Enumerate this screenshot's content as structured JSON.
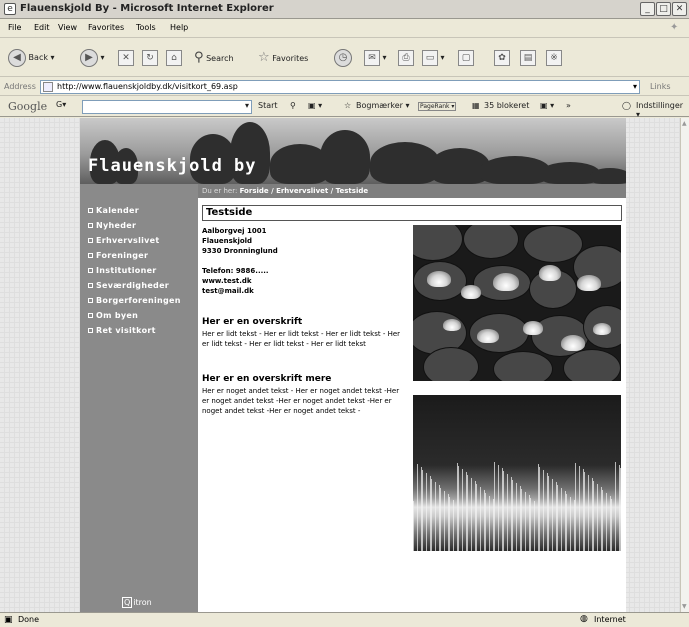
{
  "window": {
    "title": "Flauenskjold By - Microsoft Internet Explorer"
  },
  "menu": {
    "items": [
      "File",
      "Edit",
      "View",
      "Favorites",
      "Tools",
      "Help"
    ]
  },
  "toolbar": {
    "back_label": "Back",
    "search_label": "Search",
    "favorites_label": "Favorites"
  },
  "address": {
    "label": "Address",
    "url": "http://www.flauenskjoldby.dk/visitkort_69.asp",
    "links_label": "Links"
  },
  "google": {
    "logo": "Google",
    "g_label": "G▾",
    "start_label": "Start",
    "bookmarks_label": "Bogmærker ▾",
    "pagerank_label": "PageRank ▾",
    "blocked_label": "35 blokeret",
    "more_label": "»",
    "settings_label": "Indstillinger ▾"
  },
  "status": {
    "left": "Done",
    "zone": "Internet"
  },
  "site": {
    "title": "Flauenskjold by",
    "breadcrumb": {
      "prefix": "Du er her:",
      "path": "Forside / Erhvervslivet / Testside"
    },
    "nav": [
      "Kalender",
      "Nyheder",
      "Erhvervslivet",
      "Foreninger",
      "Institutioner",
      "Seværdigheder",
      "Borgerforeningen",
      "Om byen",
      "Ret visitkort"
    ],
    "footer_logo": "itron",
    "footer_logo_letter": "Q"
  },
  "page": {
    "heading": "Testside",
    "address_lines": [
      "Aalborgvej 1001",
      "Flauenskjold",
      "9330 Dronninglund"
    ],
    "contact_lines": [
      "Telefon: 9886.....",
      "www.test.dk",
      "test@mail.dk"
    ],
    "section1": {
      "heading": "Her er en overskrift",
      "text": "Her er lidt tekst - Her er lidt tekst - Her er lidt tekst - Her er lidt tekst - Her er lidt tekst - Her er lidt tekst"
    },
    "section2": {
      "heading": "Her er en overskrift mere",
      "text": "Her er noget andet tekst - Her er noget andet tekst -Her er noget andet tekst -Her er noget andet tekst -Her er noget andet tekst -Her er noget andet tekst -"
    }
  }
}
